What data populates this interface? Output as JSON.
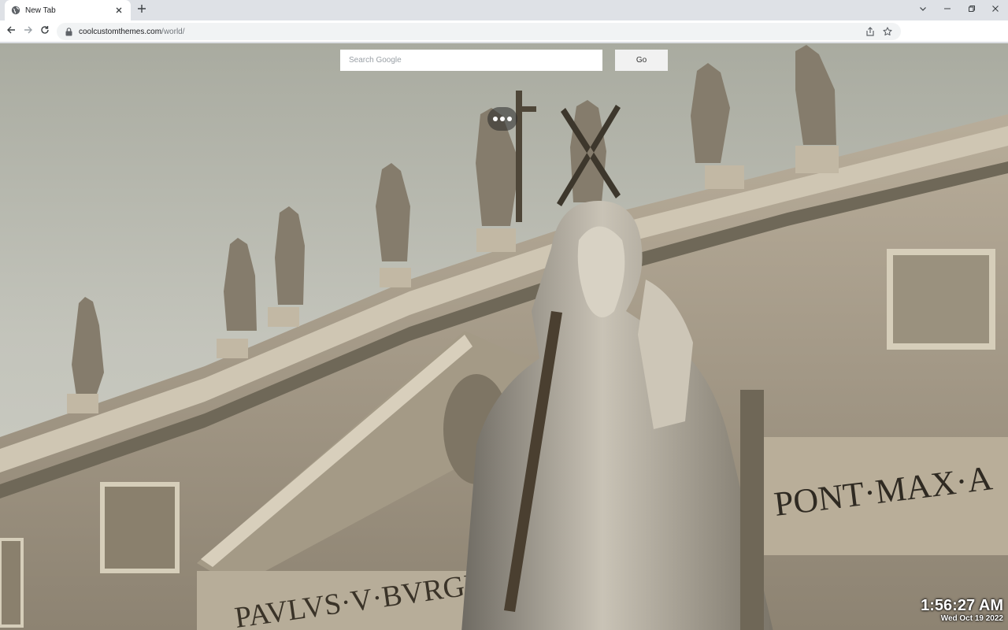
{
  "browser": {
    "tab": {
      "title": "New Tab",
      "favicon": "globe-icon",
      "close_icon": "close-icon"
    },
    "new_tab_icon": "plus-icon",
    "window_controls": [
      "chevron-down-icon",
      "minimize-icon",
      "restore-icon",
      "close-icon"
    ],
    "toolbar": {
      "back_icon": "back-arrow-icon",
      "forward_icon": "forward-arrow-icon",
      "reload_icon": "reload-icon",
      "lock_icon": "lock-icon",
      "url_host": "coolcustomthemes.com",
      "url_path": "/world/",
      "share_icon": "share-icon",
      "bookmark_icon": "star-icon"
    }
  },
  "page": {
    "search": {
      "placeholder": "Search Google",
      "value": "",
      "button_label": "Go"
    },
    "clock": {
      "time": "1:56:27 AM",
      "date": "Wed Oct 19 2022"
    },
    "background": {
      "inscription_right": "PONT·MAX·A",
      "inscription_bottom": "PAVLVS·V·BVRGHE"
    },
    "colors": {
      "tab_strip": "#dee1e6",
      "toolbar": "#ffffff",
      "omnibox": "#f1f3f4",
      "sky": "#b6b7ad",
      "stone": "#a69d8c"
    }
  }
}
